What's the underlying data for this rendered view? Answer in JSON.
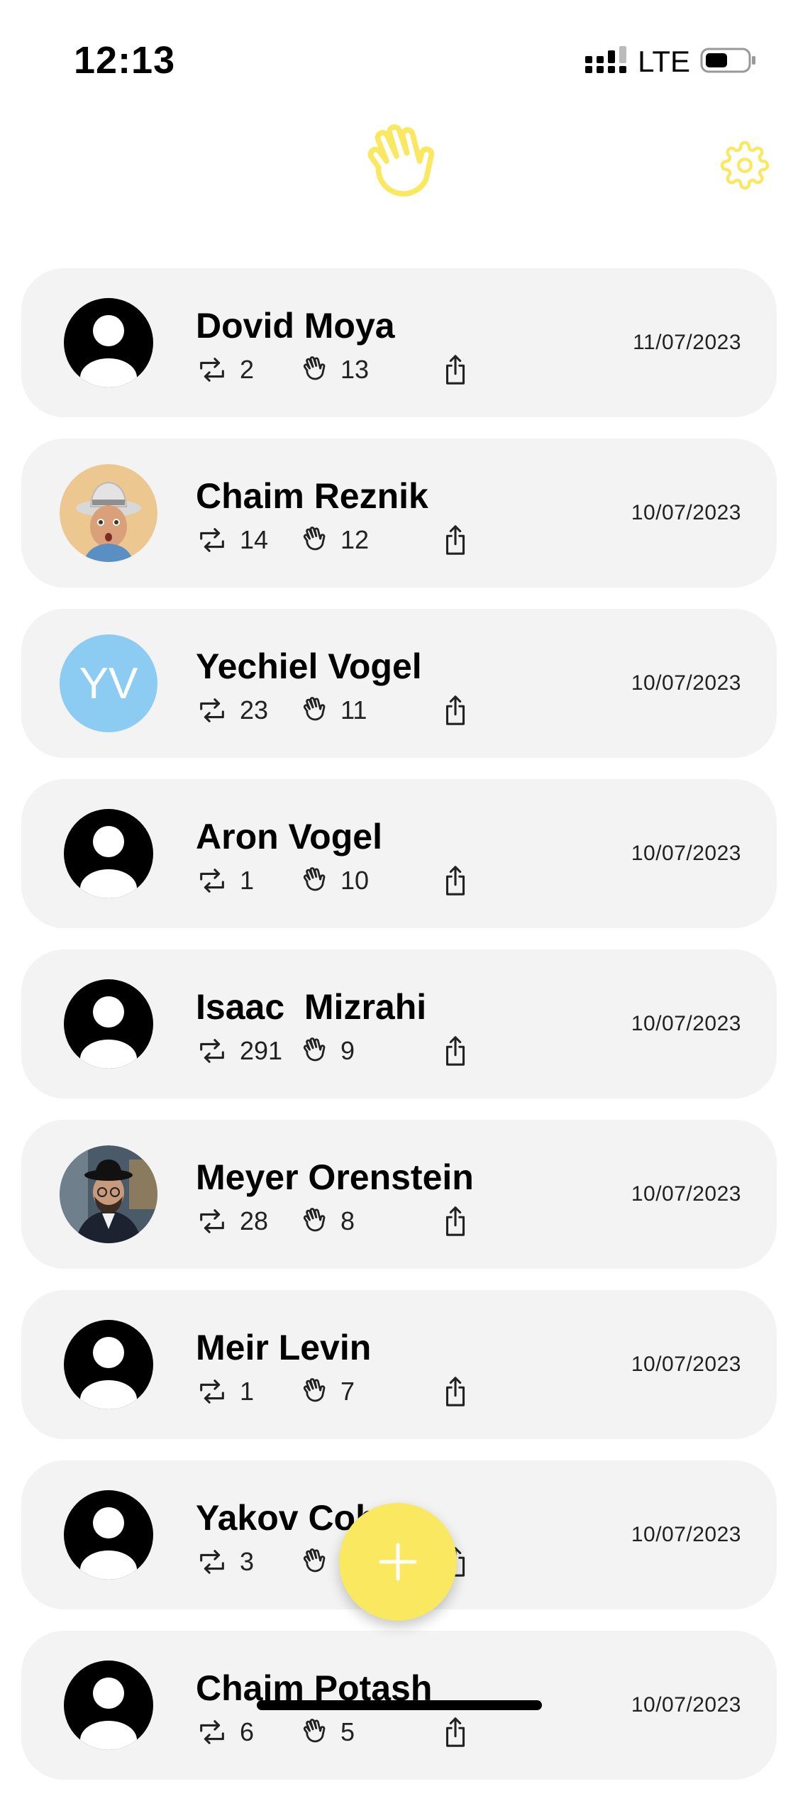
{
  "status_bar": {
    "time": "12:13",
    "network": "LTE",
    "signal_icon": "cellular-signal-icon",
    "battery_icon": "battery-icon"
  },
  "header": {
    "logo_icon": "waving-hand-icon",
    "settings_icon": "gear-icon"
  },
  "colors": {
    "accent": "#f9e860",
    "card_background": "#f3f3f3",
    "initials_avatar": "#8ccbf2"
  },
  "contacts": [
    {
      "name": "Dovid Moya",
      "reposts": "2",
      "waves": "13",
      "date": "11/07/2023",
      "avatar": "default-person-icon"
    },
    {
      "name": "Chaim Reznik",
      "reposts": "14",
      "waves": "12",
      "date": "10/07/2023",
      "avatar": "memoji-cowboy-photo"
    },
    {
      "name": "Yechiel Vogel",
      "reposts": "23",
      "waves": "11",
      "date": "10/07/2023",
      "avatar": "initials",
      "initials": "YV"
    },
    {
      "name": "Aron Vogel",
      "reposts": "1",
      "waves": "10",
      "date": "10/07/2023",
      "avatar": "default-person-icon"
    },
    {
      "name": "Isaac  Mizrahi",
      "reposts": "291",
      "waves": "9",
      "date": "10/07/2023",
      "avatar": "default-person-icon"
    },
    {
      "name": "Meyer Orenstein",
      "reposts": "28",
      "waves": "8",
      "date": "10/07/2023",
      "avatar": "profile-photo"
    },
    {
      "name": "Meir Levin",
      "reposts": "1",
      "waves": "7",
      "date": "10/07/2023",
      "avatar": "default-person-icon"
    },
    {
      "name": "Yakov Coh",
      "reposts": "3",
      "waves": "",
      "date": "10/07/2023",
      "avatar": "default-person-icon"
    },
    {
      "name": "Chaim Potash",
      "reposts": "6",
      "waves": "5",
      "date": "10/07/2023",
      "avatar": "default-person-icon"
    }
  ],
  "fab": {
    "icon": "plus-icon"
  }
}
